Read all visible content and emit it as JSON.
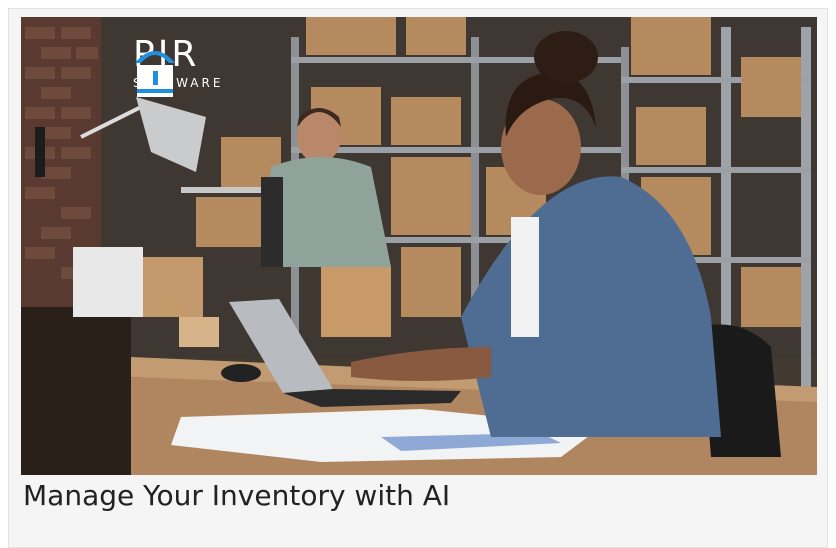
{
  "logo": {
    "name": "PJR",
    "sub": "SOFTWARE",
    "icon": "pjr-arch-logo-icon"
  },
  "caption": "Manage Your Inventory with AI",
  "colors": {
    "logo_blue": "#1f8fe0",
    "caption_text": "#222222",
    "card_bg": "#f5f5f5"
  }
}
